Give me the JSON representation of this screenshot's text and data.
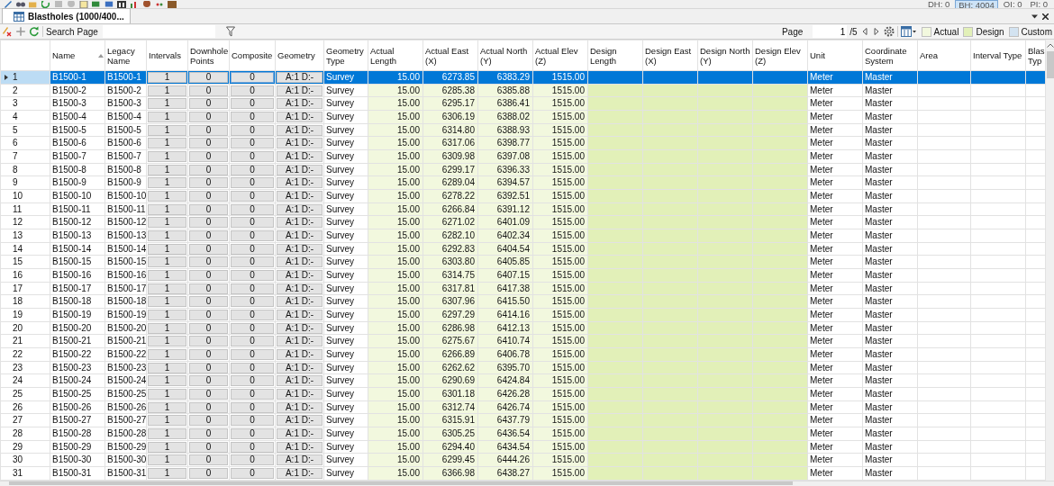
{
  "counters": [
    {
      "label": "DH: 0",
      "selected": false
    },
    {
      "label": "BH: 4004",
      "selected": true
    },
    {
      "label": "OI: 0",
      "selected": false
    },
    {
      "label": "PI: 0",
      "selected": false
    }
  ],
  "tab": {
    "title": "Blastholes (1000/400..."
  },
  "toolbar": {
    "search_label": "Search Page",
    "page_label": "Page",
    "page_value": "1",
    "page_total": "/5"
  },
  "legend": [
    {
      "label": "Actual",
      "color": "#f2f8de"
    },
    {
      "label": "Design",
      "color": "#e2f0b8"
    },
    {
      "label": "Custom",
      "color": "#d3e3f1"
    }
  ],
  "columns": [
    {
      "label": "Name",
      "kind": "text",
      "sorted": true
    },
    {
      "label": "Legacy Name",
      "kind": "text",
      "sorted": false
    },
    {
      "label": "Intervals",
      "kind": "count",
      "sorted": false
    },
    {
      "label": "Downhole Points",
      "kind": "count",
      "sorted": false
    },
    {
      "label": "Composite",
      "kind": "count",
      "sorted": false
    },
    {
      "label": "Geometry",
      "kind": "count",
      "sorted": false
    },
    {
      "label": "Geometry Type",
      "kind": "text",
      "sorted": false
    },
    {
      "label": "Actual Length",
      "kind": "actual",
      "sorted": false
    },
    {
      "label": "Actual East (X)",
      "kind": "actual",
      "sorted": false
    },
    {
      "label": "Actual North (Y)",
      "kind": "actual",
      "sorted": false
    },
    {
      "label": "Actual Elev (Z)",
      "kind": "actual",
      "sorted": false
    },
    {
      "label": "Design Length",
      "kind": "design",
      "sorted": false
    },
    {
      "label": "Design East (X)",
      "kind": "design",
      "sorted": false
    },
    {
      "label": "Design North (Y)",
      "kind": "design",
      "sorted": false
    },
    {
      "label": "Design Elev (Z)",
      "kind": "design",
      "sorted": false
    },
    {
      "label": "Unit",
      "kind": "text",
      "sorted": false
    },
    {
      "label": "Coordinate System",
      "kind": "text",
      "sorted": false
    },
    {
      "label": "Area",
      "kind": "text",
      "sorted": false
    },
    {
      "label": "Interval Type",
      "kind": "text",
      "sorted": false
    },
    {
      "label": "Blas Typ",
      "kind": "text",
      "sorted": false
    }
  ],
  "rows": [
    {
      "number": "1",
      "selected": true,
      "name": "B1500-1",
      "legacy_name": "B1500-1",
      "intervals": "1",
      "downhole_points": "0",
      "composite": "0",
      "geometry": "A:1 D:-",
      "geometry_type": "Survey",
      "actual_length": "15.00",
      "actual_east": "6273.85",
      "actual_north": "6383.29",
      "actual_elev": "1515.00",
      "unit": "Meter",
      "coordinate_system": "Master"
    },
    {
      "number": "2",
      "selected": false,
      "name": "B1500-2",
      "legacy_name": "B1500-2",
      "intervals": "1",
      "downhole_points": "0",
      "composite": "0",
      "geometry": "A:1 D:-",
      "geometry_type": "Survey",
      "actual_length": "15.00",
      "actual_east": "6285.38",
      "actual_north": "6385.88",
      "actual_elev": "1515.00",
      "unit": "Meter",
      "coordinate_system": "Master"
    },
    {
      "number": "3",
      "selected": false,
      "name": "B1500-3",
      "legacy_name": "B1500-3",
      "intervals": "1",
      "downhole_points": "0",
      "composite": "0",
      "geometry": "A:1 D:-",
      "geometry_type": "Survey",
      "actual_length": "15.00",
      "actual_east": "6295.17",
      "actual_north": "6386.41",
      "actual_elev": "1515.00",
      "unit": "Meter",
      "coordinate_system": "Master"
    },
    {
      "number": "4",
      "selected": false,
      "name": "B1500-4",
      "legacy_name": "B1500-4",
      "intervals": "1",
      "downhole_points": "0",
      "composite": "0",
      "geometry": "A:1 D:-",
      "geometry_type": "Survey",
      "actual_length": "15.00",
      "actual_east": "6306.19",
      "actual_north": "6388.02",
      "actual_elev": "1515.00",
      "unit": "Meter",
      "coordinate_system": "Master"
    },
    {
      "number": "5",
      "selected": false,
      "name": "B1500-5",
      "legacy_name": "B1500-5",
      "intervals": "1",
      "downhole_points": "0",
      "composite": "0",
      "geometry": "A:1 D:-",
      "geometry_type": "Survey",
      "actual_length": "15.00",
      "actual_east": "6314.80",
      "actual_north": "6388.93",
      "actual_elev": "1515.00",
      "unit": "Meter",
      "coordinate_system": "Master"
    },
    {
      "number": "6",
      "selected": false,
      "name": "B1500-6",
      "legacy_name": "B1500-6",
      "intervals": "1",
      "downhole_points": "0",
      "composite": "0",
      "geometry": "A:1 D:-",
      "geometry_type": "Survey",
      "actual_length": "15.00",
      "actual_east": "6317.06",
      "actual_north": "6398.77",
      "actual_elev": "1515.00",
      "unit": "Meter",
      "coordinate_system": "Master"
    },
    {
      "number": "7",
      "selected": false,
      "name": "B1500-7",
      "legacy_name": "B1500-7",
      "intervals": "1",
      "downhole_points": "0",
      "composite": "0",
      "geometry": "A:1 D:-",
      "geometry_type": "Survey",
      "actual_length": "15.00",
      "actual_east": "6309.98",
      "actual_north": "6397.08",
      "actual_elev": "1515.00",
      "unit": "Meter",
      "coordinate_system": "Master"
    },
    {
      "number": "8",
      "selected": false,
      "name": "B1500-8",
      "legacy_name": "B1500-8",
      "intervals": "1",
      "downhole_points": "0",
      "composite": "0",
      "geometry": "A:1 D:-",
      "geometry_type": "Survey",
      "actual_length": "15.00",
      "actual_east": "6299.17",
      "actual_north": "6396.33",
      "actual_elev": "1515.00",
      "unit": "Meter",
      "coordinate_system": "Master"
    },
    {
      "number": "9",
      "selected": false,
      "name": "B1500-9",
      "legacy_name": "B1500-9",
      "intervals": "1",
      "downhole_points": "0",
      "composite": "0",
      "geometry": "A:1 D:-",
      "geometry_type": "Survey",
      "actual_length": "15.00",
      "actual_east": "6289.04",
      "actual_north": "6394.57",
      "actual_elev": "1515.00",
      "unit": "Meter",
      "coordinate_system": "Master"
    },
    {
      "number": "10",
      "selected": false,
      "name": "B1500-10",
      "legacy_name": "B1500-10",
      "intervals": "1",
      "downhole_points": "0",
      "composite": "0",
      "geometry": "A:1 D:-",
      "geometry_type": "Survey",
      "actual_length": "15.00",
      "actual_east": "6278.22",
      "actual_north": "6392.51",
      "actual_elev": "1515.00",
      "unit": "Meter",
      "coordinate_system": "Master"
    },
    {
      "number": "11",
      "selected": false,
      "name": "B1500-11",
      "legacy_name": "B1500-11",
      "intervals": "1",
      "downhole_points": "0",
      "composite": "0",
      "geometry": "A:1 D:-",
      "geometry_type": "Survey",
      "actual_length": "15.00",
      "actual_east": "6266.84",
      "actual_north": "6391.12",
      "actual_elev": "1515.00",
      "unit": "Meter",
      "coordinate_system": "Master"
    },
    {
      "number": "12",
      "selected": false,
      "name": "B1500-12",
      "legacy_name": "B1500-12",
      "intervals": "1",
      "downhole_points": "0",
      "composite": "0",
      "geometry": "A:1 D:-",
      "geometry_type": "Survey",
      "actual_length": "15.00",
      "actual_east": "6271.02",
      "actual_north": "6401.09",
      "actual_elev": "1515.00",
      "unit": "Meter",
      "coordinate_system": "Master"
    },
    {
      "number": "13",
      "selected": false,
      "name": "B1500-13",
      "legacy_name": "B1500-13",
      "intervals": "1",
      "downhole_points": "0",
      "composite": "0",
      "geometry": "A:1 D:-",
      "geometry_type": "Survey",
      "actual_length": "15.00",
      "actual_east": "6282.10",
      "actual_north": "6402.34",
      "actual_elev": "1515.00",
      "unit": "Meter",
      "coordinate_system": "Master"
    },
    {
      "number": "14",
      "selected": false,
      "name": "B1500-14",
      "legacy_name": "B1500-14",
      "intervals": "1",
      "downhole_points": "0",
      "composite": "0",
      "geometry": "A:1 D:-",
      "geometry_type": "Survey",
      "actual_length": "15.00",
      "actual_east": "6292.83",
      "actual_north": "6404.54",
      "actual_elev": "1515.00",
      "unit": "Meter",
      "coordinate_system": "Master"
    },
    {
      "number": "15",
      "selected": false,
      "name": "B1500-15",
      "legacy_name": "B1500-15",
      "intervals": "1",
      "downhole_points": "0",
      "composite": "0",
      "geometry": "A:1 D:-",
      "geometry_type": "Survey",
      "actual_length": "15.00",
      "actual_east": "6303.80",
      "actual_north": "6405.85",
      "actual_elev": "1515.00",
      "unit": "Meter",
      "coordinate_system": "Master"
    },
    {
      "number": "16",
      "selected": false,
      "name": "B1500-16",
      "legacy_name": "B1500-16",
      "intervals": "1",
      "downhole_points": "0",
      "composite": "0",
      "geometry": "A:1 D:-",
      "geometry_type": "Survey",
      "actual_length": "15.00",
      "actual_east": "6314.75",
      "actual_north": "6407.15",
      "actual_elev": "1515.00",
      "unit": "Meter",
      "coordinate_system": "Master"
    },
    {
      "number": "17",
      "selected": false,
      "name": "B1500-17",
      "legacy_name": "B1500-17",
      "intervals": "1",
      "downhole_points": "0",
      "composite": "0",
      "geometry": "A:1 D:-",
      "geometry_type": "Survey",
      "actual_length": "15.00",
      "actual_east": "6317.81",
      "actual_north": "6417.38",
      "actual_elev": "1515.00",
      "unit": "Meter",
      "coordinate_system": "Master"
    },
    {
      "number": "18",
      "selected": false,
      "name": "B1500-18",
      "legacy_name": "B1500-18",
      "intervals": "1",
      "downhole_points": "0",
      "composite": "0",
      "geometry": "A:1 D:-",
      "geometry_type": "Survey",
      "actual_length": "15.00",
      "actual_east": "6307.96",
      "actual_north": "6415.50",
      "actual_elev": "1515.00",
      "unit": "Meter",
      "coordinate_system": "Master"
    },
    {
      "number": "19",
      "selected": false,
      "name": "B1500-19",
      "legacy_name": "B1500-19",
      "intervals": "1",
      "downhole_points": "0",
      "composite": "0",
      "geometry": "A:1 D:-",
      "geometry_type": "Survey",
      "actual_length": "15.00",
      "actual_east": "6297.29",
      "actual_north": "6414.16",
      "actual_elev": "1515.00",
      "unit": "Meter",
      "coordinate_system": "Master"
    },
    {
      "number": "20",
      "selected": false,
      "name": "B1500-20",
      "legacy_name": "B1500-20",
      "intervals": "1",
      "downhole_points": "0",
      "composite": "0",
      "geometry": "A:1 D:-",
      "geometry_type": "Survey",
      "actual_length": "15.00",
      "actual_east": "6286.98",
      "actual_north": "6412.13",
      "actual_elev": "1515.00",
      "unit": "Meter",
      "coordinate_system": "Master"
    },
    {
      "number": "21",
      "selected": false,
      "name": "B1500-21",
      "legacy_name": "B1500-21",
      "intervals": "1",
      "downhole_points": "0",
      "composite": "0",
      "geometry": "A:1 D:-",
      "geometry_type": "Survey",
      "actual_length": "15.00",
      "actual_east": "6275.67",
      "actual_north": "6410.74",
      "actual_elev": "1515.00",
      "unit": "Meter",
      "coordinate_system": "Master"
    },
    {
      "number": "22",
      "selected": false,
      "name": "B1500-22",
      "legacy_name": "B1500-22",
      "intervals": "1",
      "downhole_points": "0",
      "composite": "0",
      "geometry": "A:1 D:-",
      "geometry_type": "Survey",
      "actual_length": "15.00",
      "actual_east": "6266.89",
      "actual_north": "6406.78",
      "actual_elev": "1515.00",
      "unit": "Meter",
      "coordinate_system": "Master"
    },
    {
      "number": "23",
      "selected": false,
      "name": "B1500-23",
      "legacy_name": "B1500-23",
      "intervals": "1",
      "downhole_points": "0",
      "composite": "0",
      "geometry": "A:1 D:-",
      "geometry_type": "Survey",
      "actual_length": "15.00",
      "actual_east": "6262.62",
      "actual_north": "6395.70",
      "actual_elev": "1515.00",
      "unit": "Meter",
      "coordinate_system": "Master"
    },
    {
      "number": "24",
      "selected": false,
      "name": "B1500-24",
      "legacy_name": "B1500-24",
      "intervals": "1",
      "downhole_points": "0",
      "composite": "0",
      "geometry": "A:1 D:-",
      "geometry_type": "Survey",
      "actual_length": "15.00",
      "actual_east": "6290.69",
      "actual_north": "6424.84",
      "actual_elev": "1515.00",
      "unit": "Meter",
      "coordinate_system": "Master"
    },
    {
      "number": "25",
      "selected": false,
      "name": "B1500-25",
      "legacy_name": "B1500-25",
      "intervals": "1",
      "downhole_points": "0",
      "composite": "0",
      "geometry": "A:1 D:-",
      "geometry_type": "Survey",
      "actual_length": "15.00",
      "actual_east": "6301.18",
      "actual_north": "6426.28",
      "actual_elev": "1515.00",
      "unit": "Meter",
      "coordinate_system": "Master"
    },
    {
      "number": "26",
      "selected": false,
      "name": "B1500-26",
      "legacy_name": "B1500-26",
      "intervals": "1",
      "downhole_points": "0",
      "composite": "0",
      "geometry": "A:1 D:-",
      "geometry_type": "Survey",
      "actual_length": "15.00",
      "actual_east": "6312.74",
      "actual_north": "6426.74",
      "actual_elev": "1515.00",
      "unit": "Meter",
      "coordinate_system": "Master"
    },
    {
      "number": "27",
      "selected": false,
      "name": "B1500-27",
      "legacy_name": "B1500-27",
      "intervals": "1",
      "downhole_points": "0",
      "composite": "0",
      "geometry": "A:1 D:-",
      "geometry_type": "Survey",
      "actual_length": "15.00",
      "actual_east": "6315.91",
      "actual_north": "6437.79",
      "actual_elev": "1515.00",
      "unit": "Meter",
      "coordinate_system": "Master"
    },
    {
      "number": "28",
      "selected": false,
      "name": "B1500-28",
      "legacy_name": "B1500-28",
      "intervals": "1",
      "downhole_points": "0",
      "composite": "0",
      "geometry": "A:1 D:-",
      "geometry_type": "Survey",
      "actual_length": "15.00",
      "actual_east": "6305.25",
      "actual_north": "6436.54",
      "actual_elev": "1515.00",
      "unit": "Meter",
      "coordinate_system": "Master"
    },
    {
      "number": "29",
      "selected": false,
      "name": "B1500-29",
      "legacy_name": "B1500-29",
      "intervals": "1",
      "downhole_points": "0",
      "composite": "0",
      "geometry": "A:1 D:-",
      "geometry_type": "Survey",
      "actual_length": "15.00",
      "actual_east": "6294.40",
      "actual_north": "6434.54",
      "actual_elev": "1515.00",
      "unit": "Meter",
      "coordinate_system": "Master"
    },
    {
      "number": "30",
      "selected": false,
      "name": "B1500-30",
      "legacy_name": "B1500-30",
      "intervals": "1",
      "downhole_points": "0",
      "composite": "0",
      "geometry": "A:1 D:-",
      "geometry_type": "Survey",
      "actual_length": "15.00",
      "actual_east": "6299.45",
      "actual_north": "6444.26",
      "actual_elev": "1515.00",
      "unit": "Meter",
      "coordinate_system": "Master"
    },
    {
      "number": "31",
      "selected": false,
      "name": "B1500-31",
      "legacy_name": "B1500-31",
      "intervals": "1",
      "downhole_points": "0",
      "composite": "0",
      "geometry": "A:1 D:-",
      "geometry_type": "Survey",
      "actual_length": "15.00",
      "actual_east": "6366.98",
      "actual_north": "6438.27",
      "actual_elev": "1515.00",
      "unit": "Meter",
      "coordinate_system": "Master"
    }
  ]
}
